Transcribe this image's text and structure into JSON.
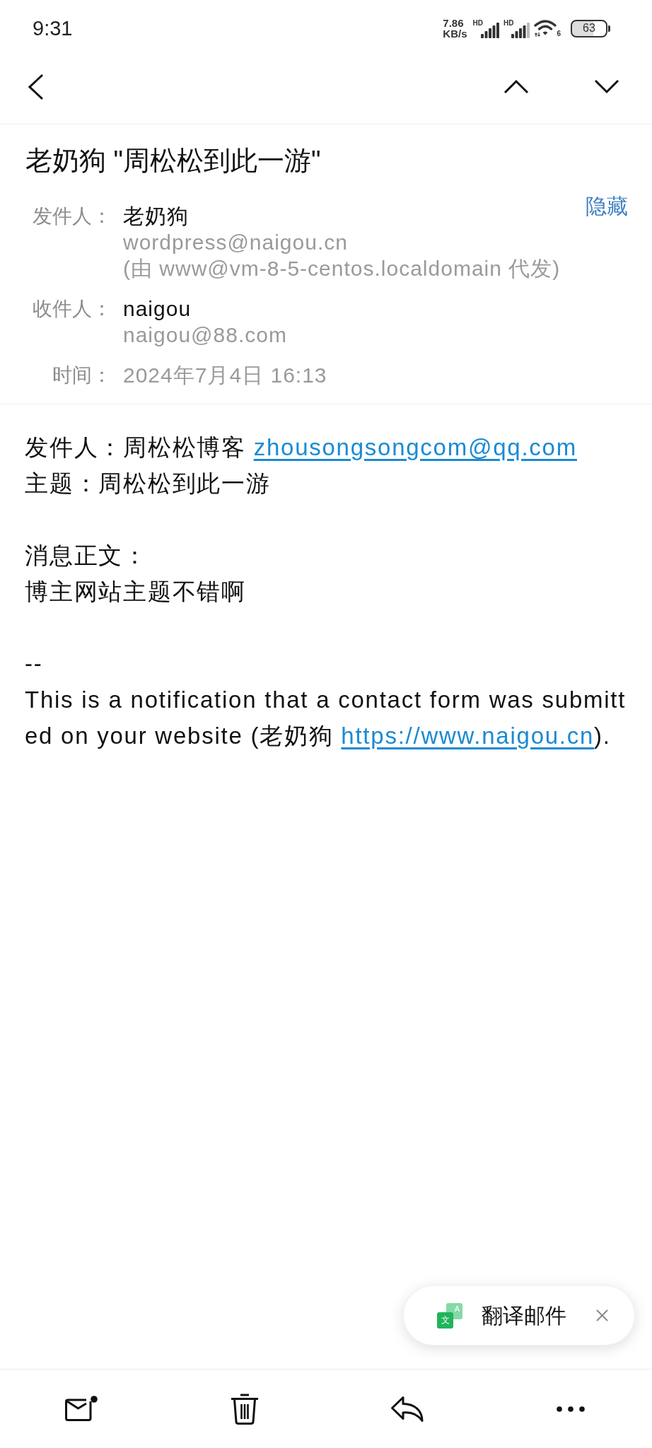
{
  "status_bar": {
    "time": "9:31",
    "network_speed": {
      "value": "7.86",
      "unit": "KB/s"
    },
    "signals": [
      {
        "badge": "HD"
      },
      {
        "badge": "HD"
      }
    ],
    "wifi_badge": "6",
    "battery": "63"
  },
  "message": {
    "subject": "老奶狗 \"周松松到此一游\"",
    "hide_link": "隐藏",
    "fields": [
      {
        "label": "发件人：",
        "name": "老奶狗",
        "details": [
          "wordpress@naigou.cn",
          "(由 www@vm-8-5-centos.localdomain 代发)"
        ]
      },
      {
        "label": "收件人：",
        "name": "naigou",
        "details": [
          "naigou@88.com"
        ]
      },
      {
        "label": "时间：",
        "details": [
          "2024年7月4日 16:13"
        ]
      }
    ]
  },
  "body": {
    "paragraphs": [
      {
        "lines": [
          {
            "parts": [
              {
                "kind": "text",
                "text": "发件人：周松松博客 "
              },
              {
                "kind": "email",
                "text": "zhousongsongcom@qq.com"
              }
            ]
          },
          {
            "parts": [
              {
                "kind": "text",
                "text": "主题：周松松到此一游"
              }
            ]
          }
        ]
      },
      {
        "lines": [
          {
            "parts": [
              {
                "kind": "text",
                "text": "消息正文："
              }
            ]
          },
          {
            "parts": [
              {
                "kind": "text",
                "text": "博主网站主题不错啊"
              }
            ]
          }
        ]
      },
      {
        "lines": [
          {
            "parts": [
              {
                "kind": "text",
                "text": "--"
              }
            ]
          },
          {
            "parts": [
              {
                "kind": "text",
                "text": "This is a notification that a contact form was submitted on your website (老奶狗 "
              },
              {
                "kind": "url",
                "text": "https://www.naigou.cn"
              },
              {
                "kind": "text",
                "text": ")."
              }
            ]
          }
        ]
      }
    ]
  },
  "translate_prompt": {
    "icon_letters": [
      "A",
      "文"
    ],
    "label": "翻译邮件"
  }
}
